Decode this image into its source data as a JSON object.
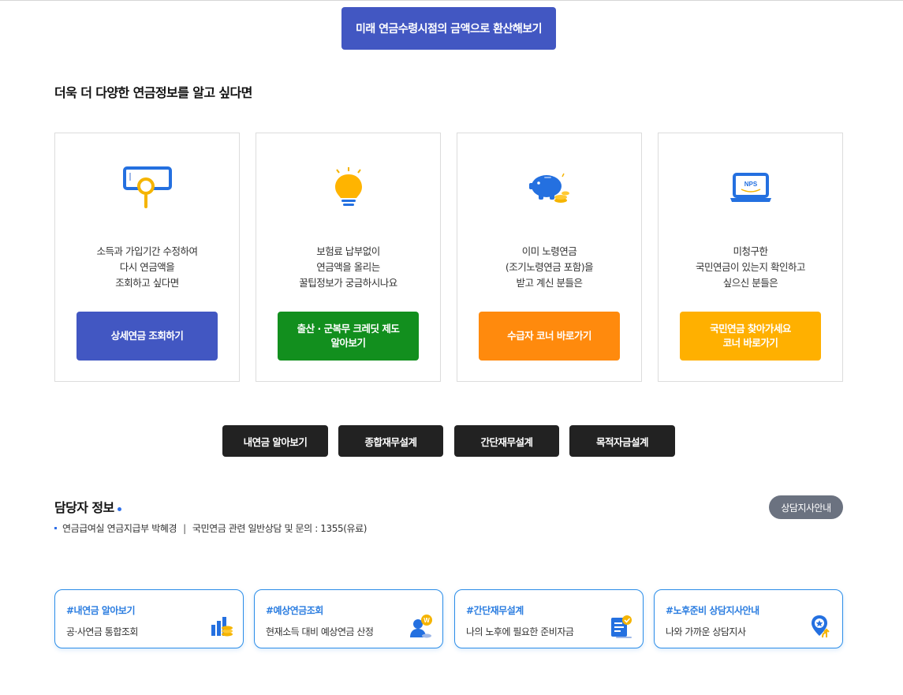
{
  "top": {
    "convert_button": "미래 연금수령시점의 금액으로 환산해보기"
  },
  "section_title": "더욱 더 다양한 연금정보를 알고 싶다면",
  "cards": [
    {
      "icon": "search-monitor-icon",
      "lines": [
        "소득과 가입기간 수정하여",
        "다시 연금액을",
        "조회하고 싶다면"
      ],
      "button_lines": [
        "상세연금 조회하기"
      ],
      "color": "#4257c2"
    },
    {
      "icon": "lightbulb-icon",
      "lines": [
        "보험료 납부없이",
        "연금액을 올리는",
        "꿀팁정보가 궁금하시나요"
      ],
      "button_lines": [
        "출산 · 군복무 크레딧 제도",
        "알아보기"
      ],
      "color": "#128f1e"
    },
    {
      "icon": "piggy-bank-icon",
      "lines": [
        "이미 노령연금",
        "(조기노령연금 포함)을",
        "받고 계신 분들은"
      ],
      "button_lines": [
        "수급자 코너 바로가기"
      ],
      "color": "#ff8a0d"
    },
    {
      "icon": "nps-laptop-icon",
      "icon_text": "NPS",
      "lines": [
        "미청구한",
        "국민연금이 있는지 확인하고",
        "싶으신 분들은"
      ],
      "button_lines": [
        "국민연금 찾아가세요",
        "코너 바로가기"
      ],
      "color": "#ffb000"
    }
  ],
  "quick_buttons": [
    "내연금 알아보기",
    "종합재무설계",
    "간단재무설계",
    "목적자금설계"
  ],
  "contact": {
    "title": "담당자 정보",
    "branch_button": "상담지사안내",
    "department": "연금급여실 연금지급부 박혜경",
    "separator": "|",
    "inquiry": "국민연금 관련 일반상담 및 문의 : 1355(유료)"
  },
  "link_cards": [
    {
      "tag": "#내연금 알아보기",
      "sub": "공·사연금 통합조회",
      "icon": "bar-chart-coins-icon"
    },
    {
      "tag": "#예상연금조회",
      "sub": "현재소득 대비 예상연금 산정",
      "icon": "user-coin-icon",
      "icon_text": "W"
    },
    {
      "tag": "#간단재무설계",
      "sub": "나의 노후에 필요한 준비자금",
      "icon": "document-check-icon"
    },
    {
      "tag": "#노후준비 상담지사안내",
      "sub": "나와 가까운 상담지사",
      "icon": "location-pin-icon"
    }
  ],
  "colors": {
    "primary": "#4257c2",
    "accent_blue": "#2b8de8",
    "dark": "#222222"
  }
}
